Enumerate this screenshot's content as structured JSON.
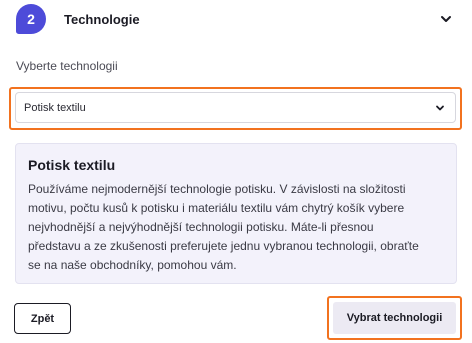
{
  "step": {
    "number": "2",
    "title": "Technologie",
    "toggle_icon": "chevron-down-icon"
  },
  "technology": {
    "label": "Vyberte technologii",
    "selected": "Potisk textilu"
  },
  "info": {
    "title": "Potisk textilu",
    "text": "Používáme nejmodernější technologie potisku. V závislosti na složitosti motivu, počtu kusů k potisku i materiálu textilu vám chytrý košík vybere nejvhodnější a nejvýhodnější technologii potisku. Máte-li přesnou představu a ze zkušenosti preferujete jednu vybranou technologii, obraťte se na naše obchodníky, pomohou vám."
  },
  "actions": {
    "back_label": "Zpět",
    "select_label": "Vybrat technologii"
  },
  "colors": {
    "accent": "#4d4bd9",
    "highlight": "#f2721f",
    "card_bg": "#f3f2fb"
  }
}
